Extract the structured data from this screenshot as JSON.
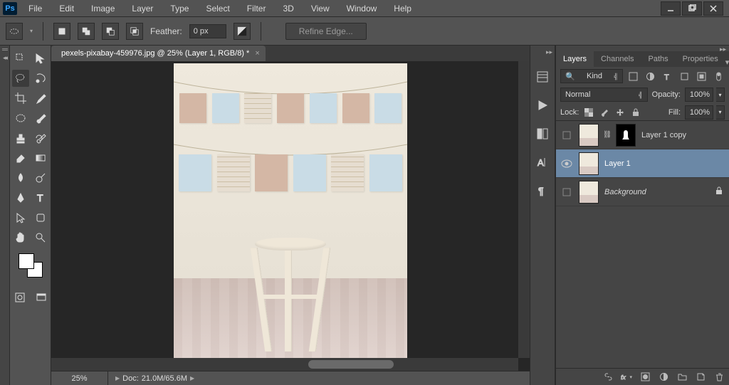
{
  "menu": {
    "items": [
      "File",
      "Edit",
      "Image",
      "Layer",
      "Type",
      "Select",
      "Filter",
      "3D",
      "View",
      "Window",
      "Help"
    ]
  },
  "options": {
    "feather_label": "Feather:",
    "feather_value": "0 px",
    "refine_label": "Refine Edge..."
  },
  "document": {
    "tab_title": "pexels-pixabay-459976.jpg @ 25% (Layer 1, RGB/8) *"
  },
  "status": {
    "zoom": "25%",
    "doc_label": "Doc:",
    "doc_value": "21.0M/65.6M"
  },
  "panel_tabs": [
    "Layers",
    "Channels",
    "Paths",
    "Properties"
  ],
  "layers_panel": {
    "filter_kind": "Kind",
    "blend_mode": "Normal",
    "opacity_label": "Opacity:",
    "opacity_value": "100%",
    "lock_label": "Lock:",
    "fill_label": "Fill:",
    "fill_value": "100%",
    "layers": [
      {
        "name": "Layer 1 copy",
        "visible": false,
        "selected": false,
        "has_mask": true,
        "locked": false,
        "italic": false
      },
      {
        "name": "Layer 1",
        "visible": true,
        "selected": true,
        "has_mask": false,
        "locked": false,
        "italic": false
      },
      {
        "name": "Background",
        "visible": false,
        "selected": false,
        "has_mask": false,
        "locked": true,
        "italic": true
      }
    ]
  },
  "ps_logo": "Ps"
}
